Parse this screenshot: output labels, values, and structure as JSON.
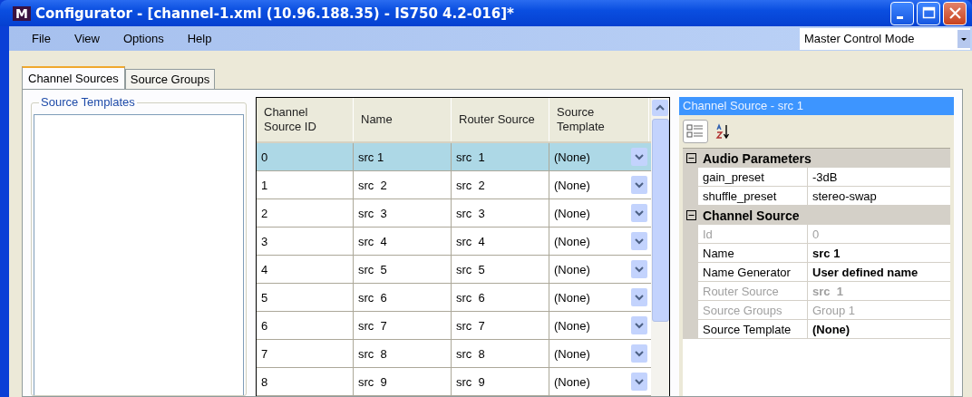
{
  "window": {
    "title": "Configurator - [channel-1.xml (10.96.188.35) - IS750 4.2-016]*",
    "logo": "M"
  },
  "menu": [
    "File",
    "View",
    "Options",
    "Help"
  ],
  "mode_select": {
    "value": "Master Control Mode"
  },
  "tabs": [
    {
      "label": "Channel Sources",
      "selected": true
    },
    {
      "label": "Source Groups",
      "selected": false
    }
  ],
  "source_templates": {
    "title": "Source Templates"
  },
  "table": {
    "columns": [
      "Channel Source ID",
      "Name",
      "Router Source",
      "Source Template"
    ],
    "rows": [
      {
        "id": "0",
        "name": "src 1",
        "router": "src  1",
        "template": "(None)",
        "selected": true
      },
      {
        "id": "1",
        "name": "src  2",
        "router": "src  2",
        "template": "(None)",
        "selected": false
      },
      {
        "id": "2",
        "name": "src  3",
        "router": "src  3",
        "template": "(None)",
        "selected": false
      },
      {
        "id": "3",
        "name": "src  4",
        "router": "src  4",
        "template": "(None)",
        "selected": false
      },
      {
        "id": "4",
        "name": "src  5",
        "router": "src  5",
        "template": "(None)",
        "selected": false
      },
      {
        "id": "5",
        "name": "src  6",
        "router": "src  6",
        "template": "(None)",
        "selected": false
      },
      {
        "id": "6",
        "name": "src  7",
        "router": "src  7",
        "template": "(None)",
        "selected": false
      },
      {
        "id": "7",
        "name": "src  8",
        "router": "src  8",
        "template": "(None)",
        "selected": false
      },
      {
        "id": "8",
        "name": "src  9",
        "router": "src  9",
        "template": "(None)",
        "selected": false
      }
    ]
  },
  "properties": {
    "title": "Channel Source - src 1",
    "categories": [
      {
        "name": "Audio Parameters",
        "expanded": true,
        "items": [
          {
            "label": "gain_preset",
            "value": "-3dB",
            "disabled": false,
            "modified": false
          },
          {
            "label": "shuffle_preset",
            "value": "stereo-swap",
            "disabled": false,
            "modified": false
          }
        ]
      },
      {
        "name": "Channel Source",
        "expanded": true,
        "items": [
          {
            "label": "Id",
            "value": "0",
            "disabled": true,
            "modified": false
          },
          {
            "label": "Name",
            "value": "src 1",
            "disabled": false,
            "modified": true
          },
          {
            "label": "Name Generator",
            "value": "User defined name",
            "disabled": false,
            "modified": true
          },
          {
            "label": "Router Source",
            "value": "src  1",
            "disabled": true,
            "modified": true
          },
          {
            "label": "Source Groups",
            "value": "Group 1",
            "disabled": true,
            "modified": false
          },
          {
            "label": "Source Template",
            "value": "(None)",
            "disabled": false,
            "modified": true
          }
        ]
      }
    ]
  }
}
